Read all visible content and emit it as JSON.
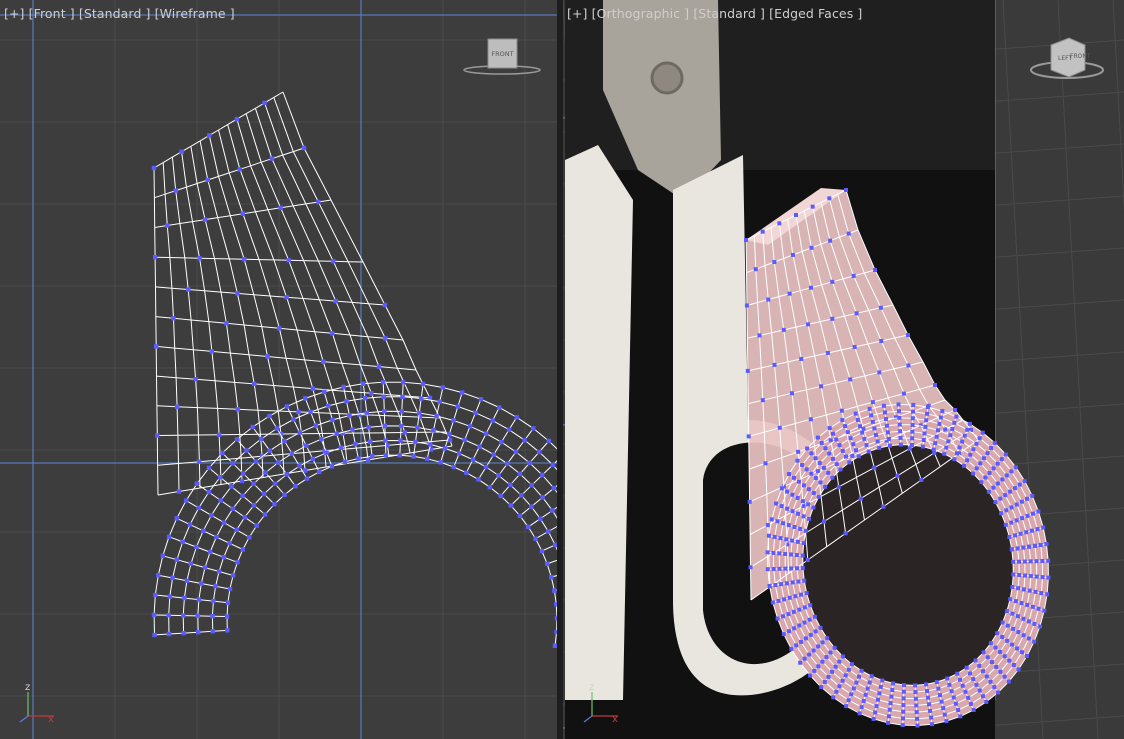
{
  "viewports": {
    "left": {
      "label_plus": "[+]",
      "label_view": "[Front ]",
      "label_shading_a": "[Standard ]",
      "label_shading_b": "[Wireframe ]",
      "viewcube_face": "FRONT"
    },
    "right": {
      "label_plus": "[+]",
      "label_view": "[Orthographic ]",
      "label_shading_a": "[Standard ]",
      "label_shading_b": "[Edged Faces ]",
      "viewcube_face_a": "LEFT",
      "viewcube_face_b": "FRONT"
    }
  },
  "colors": {
    "viewport_bg_left": "#3d3d3d",
    "viewport_bg_right": "#3a3a3a",
    "grid_line": "#4a4a4a",
    "home_grid_axis": "#5a86d6",
    "wire": "#ffffff",
    "vertex": "#5b5bff",
    "mesh_face": "#e9c2c2",
    "photo_bg": "#111111",
    "handle_white": "#e8e6df",
    "blade_metal": "#a8a39b"
  },
  "icons": {
    "viewcube": "viewcube-icon",
    "axis_tripod": "axis-tripod-icon"
  },
  "axis_labels": {
    "x": "x",
    "y": "y",
    "z": "z"
  }
}
